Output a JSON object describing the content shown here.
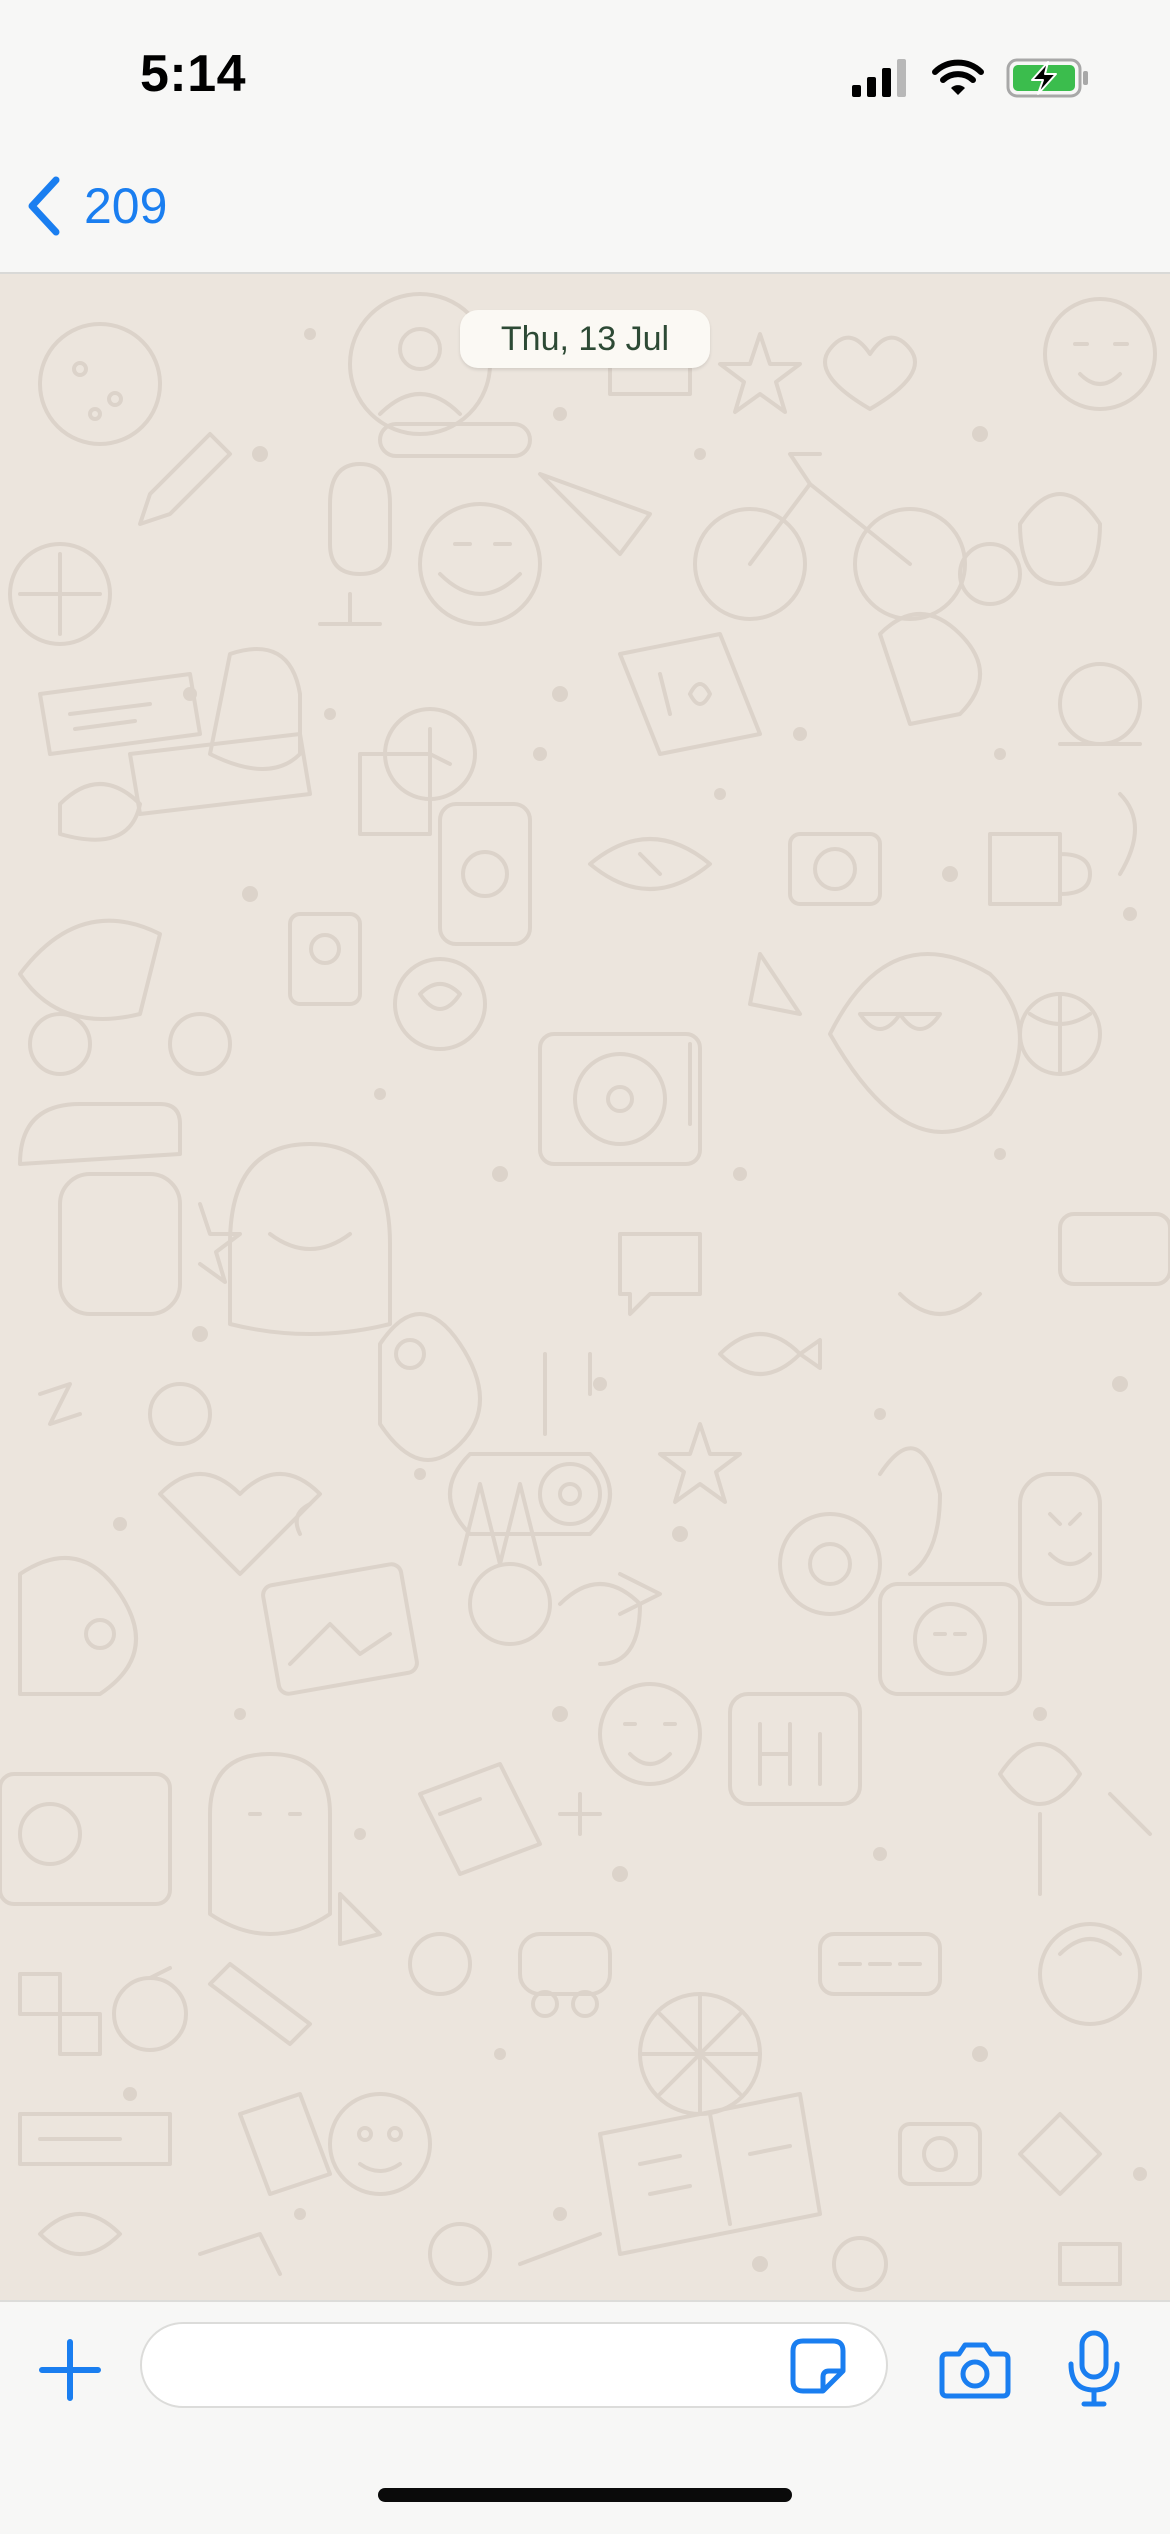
{
  "status_bar": {
    "time": "5:14",
    "icons": [
      "signal-icon",
      "wifi-icon",
      "battery-charging-icon"
    ]
  },
  "nav": {
    "back_label": "209",
    "back_icon": "chevron-left-icon",
    "accent_color": "#1a7ef0"
  },
  "chat": {
    "date_label": "Thu, 13 Jul",
    "wallpaper_color": "#ece5dd"
  },
  "composer": {
    "message_value": "",
    "icons": [
      "plus-icon",
      "sticker-icon",
      "camera-icon",
      "microphone-icon"
    ]
  }
}
